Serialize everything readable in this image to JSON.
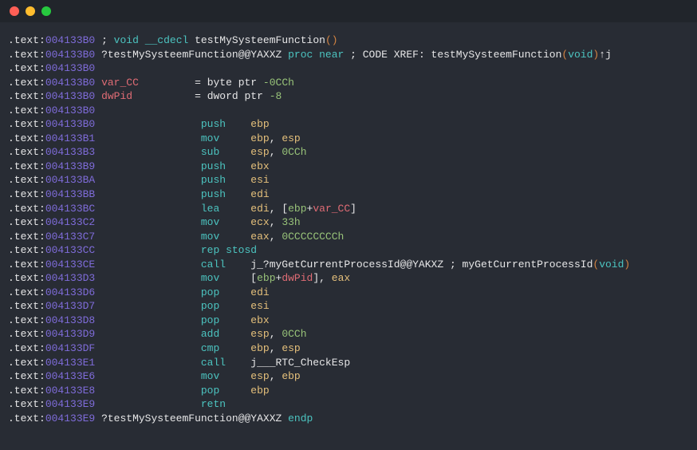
{
  "titlebar": {
    "buttons": [
      "close",
      "minimize",
      "maximize"
    ]
  },
  "asm": {
    "section": ".text",
    "lines": [
      {
        "addr": "004133B0",
        "t": "cmt",
        "text": "; void __cdecl testMySysteemFunction()",
        "highlights": [
          {
            "s": 7,
            "e": 14,
            "cls": "teal"
          },
          {
            "s": 15,
            "e": 36,
            "cls": "white"
          },
          {
            "s": 36,
            "e": 38,
            "cls": "orange"
          }
        ]
      },
      {
        "addr": "004133B0",
        "t": "proc",
        "name": "?testMySysteemFunction@@YAXXZ",
        "suffix": " proc near ",
        "xref": "; CODE XREF: testMySysteemFunction(void)↑j"
      },
      {
        "addr": "004133B0",
        "t": "blank"
      },
      {
        "addr": "004133B0",
        "t": "var",
        "name": "var_CC",
        "op": "= byte ptr ",
        "val": "-0CCh"
      },
      {
        "addr": "004133B0",
        "t": "var",
        "name": "dwPid",
        "op": "= dword ptr ",
        "val": "-8"
      },
      {
        "addr": "004133B0",
        "t": "blank"
      },
      {
        "addr": "004133B0",
        "t": "ins",
        "mnem": "push",
        "ops": [
          {
            "text": "ebp",
            "cls": "yellow"
          }
        ]
      },
      {
        "addr": "004133B1",
        "t": "ins",
        "mnem": "mov",
        "ops": [
          {
            "text": "ebp",
            "cls": "yellow"
          },
          {
            "text": "esp",
            "cls": "yellow"
          }
        ]
      },
      {
        "addr": "004133B3",
        "t": "ins",
        "mnem": "sub",
        "ops": [
          {
            "text": "esp",
            "cls": "yellow"
          },
          {
            "text": "0CCh",
            "cls": "green"
          }
        ]
      },
      {
        "addr": "004133B9",
        "t": "ins",
        "mnem": "push",
        "ops": [
          {
            "text": "ebx",
            "cls": "yellow"
          }
        ]
      },
      {
        "addr": "004133BA",
        "t": "ins",
        "mnem": "push",
        "ops": [
          {
            "text": "esi",
            "cls": "yellow"
          }
        ]
      },
      {
        "addr": "004133BB",
        "t": "ins",
        "mnem": "push",
        "ops": [
          {
            "text": "edi",
            "cls": "yellow"
          }
        ]
      },
      {
        "addr": "004133BC",
        "t": "ins",
        "mnem": "lea",
        "ops": [
          {
            "text": "edi",
            "cls": "yellow"
          },
          {
            "text": "[ebp+var_CC]",
            "cls": "mem"
          }
        ]
      },
      {
        "addr": "004133C2",
        "t": "ins",
        "mnem": "mov",
        "ops": [
          {
            "text": "ecx",
            "cls": "yellow"
          },
          {
            "text": "33h",
            "cls": "green"
          }
        ]
      },
      {
        "addr": "004133C7",
        "t": "ins",
        "mnem": "mov",
        "ops": [
          {
            "text": "eax",
            "cls": "yellow"
          },
          {
            "text": "0CCCCCCCCh",
            "cls": "green"
          }
        ]
      },
      {
        "addr": "004133CC",
        "t": "ins",
        "mnem": "rep stosd",
        "ops": []
      },
      {
        "addr": "004133CE",
        "t": "ins",
        "mnem": "call",
        "ops": [
          {
            "text": "j_?myGetCurrentProcessId@@YAKXZ",
            "cls": "white"
          }
        ],
        "cmt": " ; myGetCurrentProcessId(void)"
      },
      {
        "addr": "004133D3",
        "t": "ins",
        "mnem": "mov",
        "ops": [
          {
            "text": "[ebp+dwPid]",
            "cls": "mem"
          },
          {
            "text": "eax",
            "cls": "yellow"
          }
        ]
      },
      {
        "addr": "004133D6",
        "t": "ins",
        "mnem": "pop",
        "ops": [
          {
            "text": "edi",
            "cls": "yellow"
          }
        ]
      },
      {
        "addr": "004133D7",
        "t": "ins",
        "mnem": "pop",
        "ops": [
          {
            "text": "esi",
            "cls": "yellow"
          }
        ]
      },
      {
        "addr": "004133D8",
        "t": "ins",
        "mnem": "pop",
        "ops": [
          {
            "text": "ebx",
            "cls": "yellow"
          }
        ]
      },
      {
        "addr": "004133D9",
        "t": "ins",
        "mnem": "add",
        "ops": [
          {
            "text": "esp",
            "cls": "yellow"
          },
          {
            "text": "0CCh",
            "cls": "green"
          }
        ]
      },
      {
        "addr": "004133DF",
        "t": "ins",
        "mnem": "cmp",
        "ops": [
          {
            "text": "ebp",
            "cls": "yellow"
          },
          {
            "text": "esp",
            "cls": "yellow"
          }
        ]
      },
      {
        "addr": "004133E1",
        "t": "ins",
        "mnem": "call",
        "ops": [
          {
            "text": "j___RTC_CheckEsp",
            "cls": "white"
          }
        ]
      },
      {
        "addr": "004133E6",
        "t": "ins",
        "mnem": "mov",
        "ops": [
          {
            "text": "esp",
            "cls": "yellow"
          },
          {
            "text": "ebp",
            "cls": "yellow"
          }
        ]
      },
      {
        "addr": "004133E8",
        "t": "ins",
        "mnem": "pop",
        "ops": [
          {
            "text": "ebp",
            "cls": "yellow"
          }
        ]
      },
      {
        "addr": "004133E9",
        "t": "ins",
        "mnem": "retn",
        "ops": []
      },
      {
        "addr": "004133E9",
        "t": "endp",
        "name": "?testMySysteemFunction@@YAXXZ",
        "suffix": " endp"
      }
    ]
  }
}
